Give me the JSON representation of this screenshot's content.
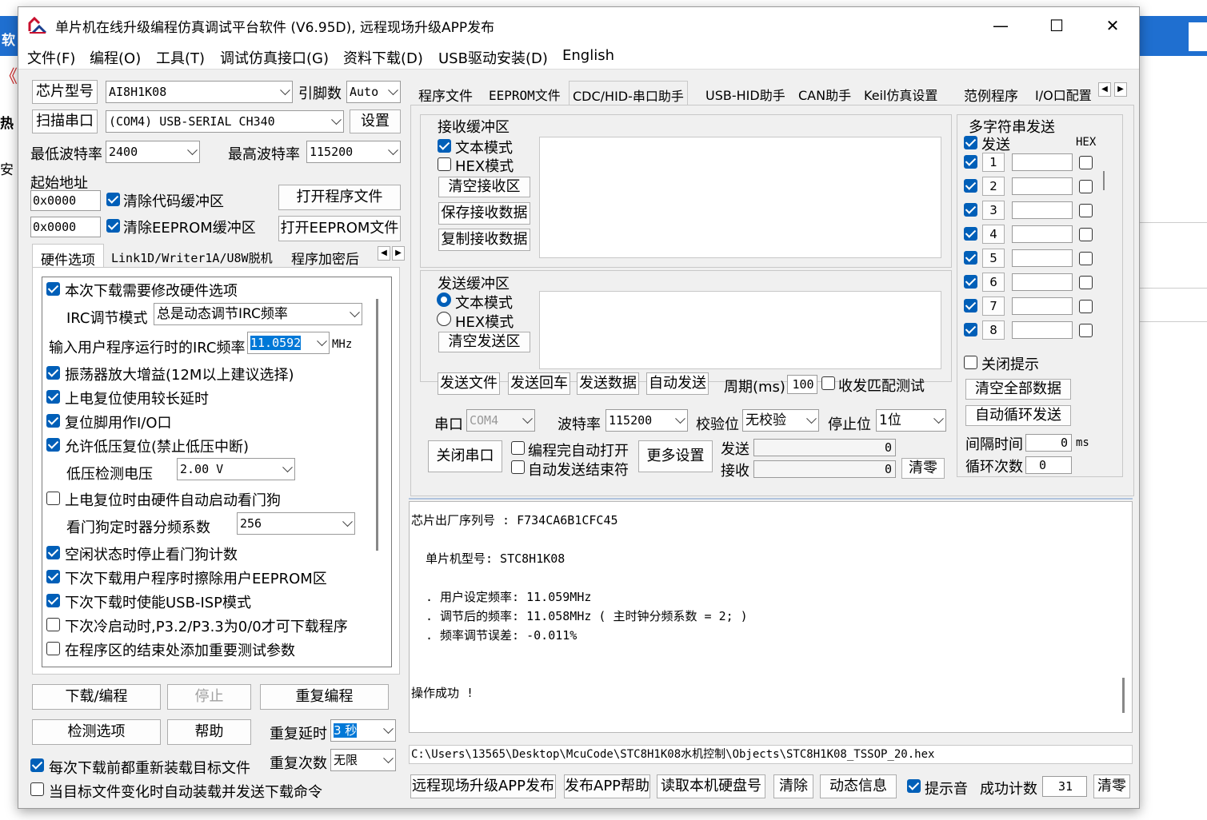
{
  "app": {
    "title": "单片机在线升级编程仿真调试平台软件 (V6.95D), 远程现场升级APP发布",
    "minimize": "—",
    "maximize": "☐",
    "close": "✕"
  },
  "menu": [
    "文件(F)",
    "编程(O)",
    "工具(T)",
    "调试仿真接口(G)",
    "资料下载(D)",
    "USB驱动安装(D)",
    "English"
  ],
  "left": {
    "chip_label": "芯片型号",
    "chip_value": "AI8H1K08",
    "pin_label": "引脚数",
    "pin_value": "Auto",
    "scan_label": "扫描串口",
    "port_value": "(COM4) USB-SERIAL CH340",
    "settings_label": "设置",
    "min_baud_label": "最低波特率",
    "min_baud_value": "2400",
    "max_baud_label": "最高波特率",
    "max_baud_value": "115200",
    "start_addr_label": "起始地址",
    "addr1": "0x0000",
    "clear_code_label": "清除代码缓冲区",
    "open_prog_label": "打开程序文件",
    "addr2": "0x0000",
    "clear_eeprom_label": "清除EEPROM缓冲区",
    "open_eeprom_label": "打开EEPROM文件",
    "tabs": [
      "硬件选项",
      "Link1D/Writer1A/U8W脱机",
      "程序加密后"
    ],
    "options": {
      "modify_hw": "本次下载需要修改硬件选项",
      "irc_mode_label": "IRC调节模式",
      "irc_mode_value": "总是动态调节IRC频率",
      "irc_freq_label": "输入用户程序运行时的IRC频率",
      "irc_freq_value": "11.0592",
      "irc_unit": "MHz",
      "osc_gain": "振荡器放大增益(12M以上建议选择)",
      "power_delay": "上电复位使用较长延时",
      "reset_io": "复位脚用作I/O口",
      "lvd_reset": "允许低压复位(禁止低压中断)",
      "lvd_label": "低压检测电压",
      "lvd_value": "2.00 V",
      "wdt_auto": "上电复位时由硬件自动启动看门狗",
      "wdt_div_label": "看门狗定时器分频系数",
      "wdt_div_value": "256",
      "idle_wdt": "空闲状态时停止看门狗计数",
      "erase_eeprom": "下次下载用户程序时擦除用户EEPROM区",
      "usb_isp": "下次下载时使能USB-ISP模式",
      "p32_p33": "下次冷启动时,P3.2/P3.3为0/0才可下载程序",
      "test_param": "在程序区的结束处添加重要测试参数"
    },
    "download_label": "下载/编程",
    "stop_label": "停止",
    "reprogram_label": "重复编程",
    "check_label": "检测选项",
    "help_label": "帮助",
    "repeat_delay_label": "重复延时",
    "repeat_delay_value": "3 秒",
    "repeat_count_label": "重复次数",
    "repeat_count_value": "无限",
    "reload_label": "每次下载前都重新装载目标文件",
    "autosend_label": "当目标文件变化时自动装载并发送下载命令"
  },
  "right_tabs": [
    "程序文件",
    "EEPROM文件",
    "CDC/HID-串口助手",
    "USB-HID助手",
    "CAN助手",
    "Keil仿真设置",
    "范例程序",
    "I/O口配置"
  ],
  "serial": {
    "rx_group": "接收缓冲区",
    "rx_text_mode": "文本模式",
    "rx_hex_mode": "HEX模式",
    "rx_clear": "清空接收区",
    "rx_save": "保存接收数据",
    "rx_copy": "复制接收数据",
    "tx_group": "发送缓冲区",
    "tx_text_mode": "文本模式",
    "tx_hex_mode": "HEX模式",
    "tx_clear": "清空发送区",
    "send_file": "发送文件",
    "send_cr": "发送回车",
    "send_data": "发送数据",
    "auto_send": "自动发送",
    "period_label": "周期(ms)",
    "period_value": "100",
    "match_test": "收发匹配测试",
    "port_label": "串口",
    "port_value": "COM4",
    "baud_label": "波特率",
    "baud_value": "115200",
    "parity_label": "校验位",
    "parity_value": "无校验",
    "stop_label": "停止位",
    "stop_value": "1位",
    "close_port": "关闭串口",
    "auto_open": "编程完自动打开",
    "auto_end": "自动发送结束符",
    "more_settings": "更多设置",
    "tx_label": "发送",
    "tx_count": "0",
    "rx_label": "接收",
    "rx_count": "0",
    "clear_count": "清零",
    "multi_title": "多字符串发送",
    "multi_send": "发送",
    "multi_hex": "HEX",
    "rows": [
      "1",
      "2",
      "3",
      "4",
      "5",
      "6",
      "7",
      "8"
    ],
    "close_tip": "关闭提示",
    "clear_all": "清空全部数据",
    "auto_loop": "自动循环发送",
    "interval_label": "间隔时间",
    "interval_value": "0",
    "interval_unit": "ms",
    "loop_label": "循环次数",
    "loop_value": "0"
  },
  "log": {
    "serial_no": "芯片出厂序列号 : F734CA6B1CFC45",
    "model": "单片机型号: STC8H1K08",
    "user_freq": ". 用户设定频率: 11.059MHz",
    "adj_freq": ". 调节后的频率: 11.058MHz ( 主时钟分频系数 = 2; )",
    "freq_err": ". 频率调节误差: -0.011%",
    "success": "操作成功 !"
  },
  "path": "C:\\Users\\13565\\Desktop\\McuCode\\STC8H1K08水机控制\\Objects\\STC8H1K08_TSSOP_20.hex",
  "bottom": {
    "remote_app": "远程现场升级APP发布",
    "app_help": "发布APP帮助",
    "read_disk": "读取本机硬盘号",
    "clear": "清除",
    "dynamic": "动态信息",
    "sound": "提示音",
    "success_count_label": "成功计数",
    "success_count": "31",
    "reset": "清零"
  },
  "colors": {
    "accent": "#005fb8",
    "selection": "#0078d7",
    "bg_window": "#f0f0f0",
    "bg_top": "#1f6fd0"
  }
}
